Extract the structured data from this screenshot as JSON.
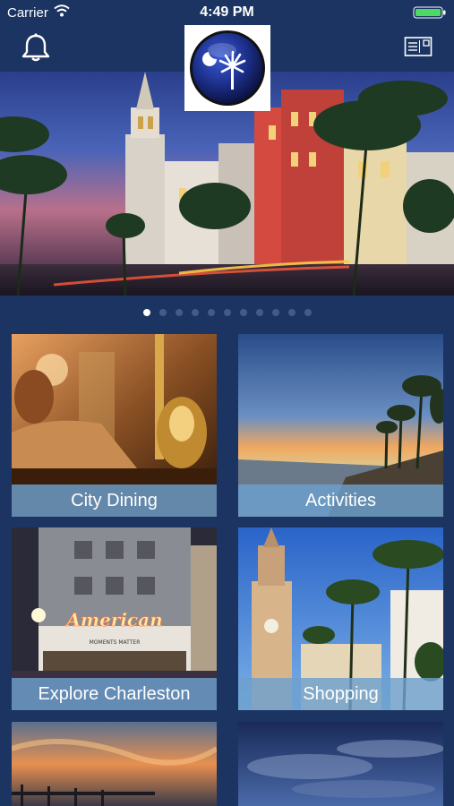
{
  "status_bar": {
    "carrier": "Carrier",
    "time": "4:49 PM",
    "wifi_icon": "wifi-icon",
    "battery_icon": "battery-full-icon"
  },
  "nav": {
    "left_icon": "bell-icon",
    "logo_icon": "palmetto-moon-logo",
    "right_icon": "postcard-icon"
  },
  "carousel": {
    "page_count": 11,
    "active_index": 0
  },
  "tiles": [
    {
      "label": "City Dining"
    },
    {
      "label": "Activities"
    },
    {
      "label": "Explore Charleston"
    },
    {
      "label": "Shopping"
    },
    {
      "label": ""
    },
    {
      "label": ""
    }
  ],
  "theatre_sign": {
    "marquee": "American",
    "subtitle": "MOMENTS MATTER"
  },
  "colors": {
    "background": "#1b3461",
    "label_bar": "#6ca0cd",
    "battery": "#4cd964"
  }
}
